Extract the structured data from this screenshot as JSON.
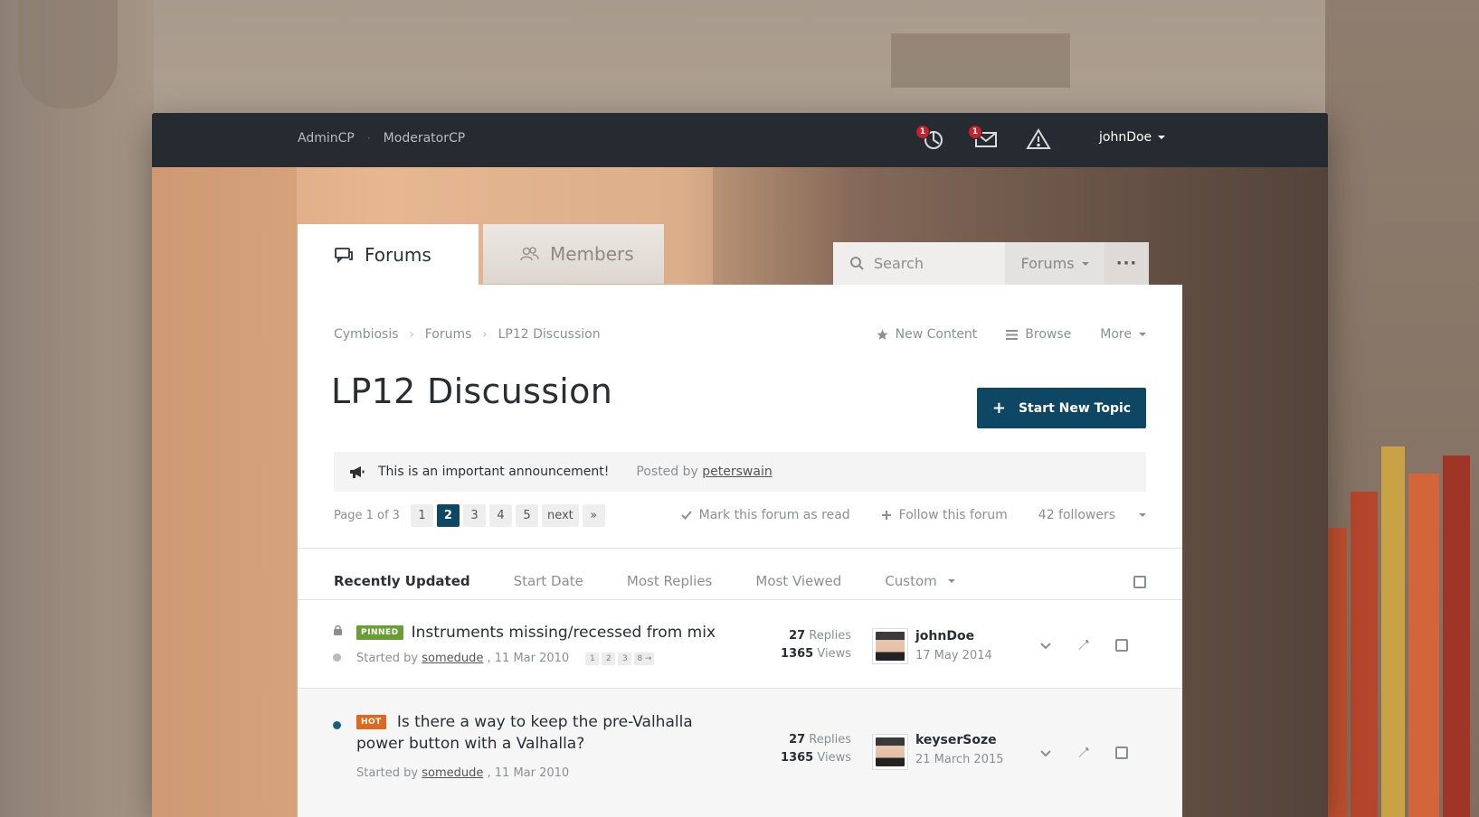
{
  "topbar": {
    "admin_links": [
      "AdminCP",
      "ModeratorCP"
    ],
    "separator": "·",
    "notifications_badge": "1",
    "messages_badge": "1",
    "username": "johnDoe",
    "icons": [
      "notifications-icon",
      "messages-icon",
      "reports-icon"
    ]
  },
  "tabs": {
    "forums": "Forums",
    "members": "Members"
  },
  "search": {
    "placeholder": "Search",
    "scope": "Forums",
    "more": "···"
  },
  "breadcrumb": [
    "Cymbiosis",
    "Forums",
    "LP12 Discussion"
  ],
  "page_actions": {
    "new_content": "New Content",
    "browse": "Browse",
    "more": "More"
  },
  "page": {
    "title": "LP12 Discussion",
    "start_button": "Start New Topic"
  },
  "announcement": {
    "text": "This is an important announcement!",
    "posted_by_label": "Posted by",
    "author": "peterswain"
  },
  "pagination": {
    "label": "Page 1 of 3",
    "pages": [
      "1",
      "2",
      "3",
      "4",
      "5"
    ],
    "active": "2",
    "next": "next",
    "last": "»"
  },
  "forum_actions": {
    "mark_read": "Mark this forum as read",
    "follow": "Follow this forum",
    "followers": "42 followers"
  },
  "sort": {
    "options": [
      "Recently Updated",
      "Start Date",
      "Most Replies",
      "Most Viewed"
    ],
    "custom": "Custom",
    "active": "Recently Updated"
  },
  "topics": [
    {
      "tag": "PINNED",
      "title": "Instruments missing/recessed from mix",
      "started_by_label": "Started by",
      "author": "somedude",
      "date": ", 11 Mar 2010",
      "mini_pages": [
        "1",
        "2",
        "3",
        "8 →"
      ],
      "replies": "27",
      "replies_label": "Replies",
      "views": "1365",
      "views_label": "Views",
      "last_poster": "johnDoe",
      "last_date": "17 May 2014"
    },
    {
      "tag": "HOT",
      "title_line1": "Is there a way to keep the pre-Valhalla",
      "title_line2": "power button with a Valhalla?",
      "started_by_label": "Started by",
      "author": "somedude",
      "date": ", 11 Mar 2010",
      "replies": "27",
      "replies_label": "Replies",
      "views": "1365",
      "views_label": "Views",
      "last_poster": "keyserSoze",
      "last_date": "21 March 2015"
    }
  ],
  "colors": {
    "accent": "#0d4764",
    "topbar": "#262b31",
    "pinned": "#6a9d33",
    "hot": "#e0681c",
    "badge": "#c5222e"
  }
}
